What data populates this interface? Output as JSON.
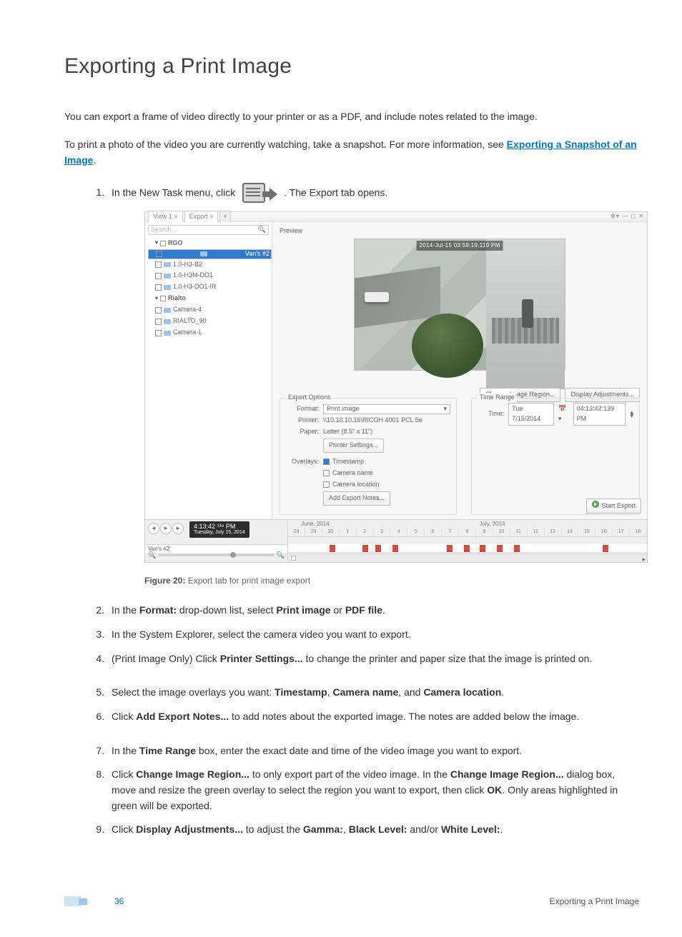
{
  "heading": "Exporting a Print Image",
  "intro1": "You can export a frame of video directly to your printer or as a PDF, and include notes related to the image.",
  "intro2_a": "To print a photo of the video you are currently watching, take a snapshot. For more information, see ",
  "intro2_link": "Exporting a Snapshot of an Image",
  "intro2_b": ".",
  "step1_a": "In the New Task menu, click ",
  "step1_b": ". The Export tab opens.",
  "figcap_prefix": "Figure 20:",
  "figcap_body": " Export tab for print image export",
  "step2": {
    "a": "In the ",
    "b": "Format:",
    "c": " drop-down list, select ",
    "d": "Print image",
    "e": " or ",
    "f": "PDF file",
    "g": "."
  },
  "step3": "In the System Explorer, select the camera video you want to export.",
  "step4": {
    "a": "(Print Image Only) Click ",
    "b": "Printer Settings...",
    "c": " to change the printer and paper size that the image is printed on."
  },
  "step5": {
    "a": "Select the image overlays you want: ",
    "b": "Timestamp",
    "c": ", ",
    "d": "Camera name",
    "e": ", and ",
    "f": "Camera location",
    "g": "."
  },
  "step6": {
    "a": "Click ",
    "b": "Add Export Notes...",
    "c": " to add notes about the exported image. The notes are added below the image."
  },
  "step7": {
    "a": "In the ",
    "b": "Time Range",
    "c": " box, enter the exact date and time of the video image you want to export."
  },
  "step8": {
    "a": "Click ",
    "b": "Change Image Region...",
    "c": " to only export part of the video image. In the ",
    "d": "Change Image Region...",
    "e": " dialog box, move and resize the green overlay to select the region you want to export, then click ",
    "f": "OK",
    "g": ". Only areas highlighted in green will be exported."
  },
  "step9": {
    "a": "Click ",
    "b": "Display Adjustments...",
    "c": " to adjust the ",
    "d": "Gamma:",
    "e": ", ",
    "f": "Black Level:",
    "g": " and/or ",
    "h": "White Level:",
    "i": "."
  },
  "page_number": "36",
  "footer_title": "Exporting a Print Image",
  "shot": {
    "tabs": {
      "view": "View 1  ×",
      "export": "Export  ×",
      "plus": "+"
    },
    "winbtns": "⚙▾   —   ◻   ✕",
    "search": "Search…",
    "tree": {
      "site1": "RGO",
      "cam_sel": "Van's #2",
      "cam2": "1.0-H3-B2",
      "cam3": "1.0-H3M-DO1",
      "cam4": "1.0-H3-DO1-IR",
      "site2": "Rialto",
      "camA": "Camera-4",
      "camB": "RIALTO_90",
      "camC": "Camera-1"
    },
    "preview_label": "Preview",
    "overlay_ts": "2014-Jul-15 03:59:19.119 PM",
    "btn_region": "Change Image Region...",
    "btn_adjust": "Display Adjustments...",
    "grp_export": "Export Options",
    "grp_time": "Time Range",
    "format_label": "Format:",
    "format_value": "Print image",
    "printer_label": "Printer:",
    "printer_value": "\\\\10.10.10.16\\RICOH 4001 PCL 5e",
    "paper_label": "Paper:",
    "paper_value": "Letter (8.5\" x 11\")",
    "printer_settings_btn": "Printer Settings...",
    "overlays_label": "Overlays:",
    "ov_ts": "Timestamp",
    "ov_name": "Camera name",
    "ov_loc": "Camera location",
    "add_notes_btn": "Add Export Notes...",
    "time_label": "Time:",
    "time_date": "Tue  7/15/2014",
    "time_time": "04:13:42:139 PM",
    "start_export": "Start Export",
    "tl_month1": "June, 2014",
    "tl_month2": "July, 2014",
    "tl_days": [
      "28",
      "29",
      "30",
      "1",
      "2",
      "3",
      "4",
      "5",
      "6",
      "7",
      "8",
      "9",
      "10",
      "11",
      "12",
      "13",
      "14",
      "15",
      "16",
      "17",
      "18"
    ],
    "tl_chip_time": "4:13:42 ¹³⁹ PM",
    "tl_chip_date": "Tuesday, July 15, 2014",
    "tl_lane_label": "Van's #2"
  }
}
